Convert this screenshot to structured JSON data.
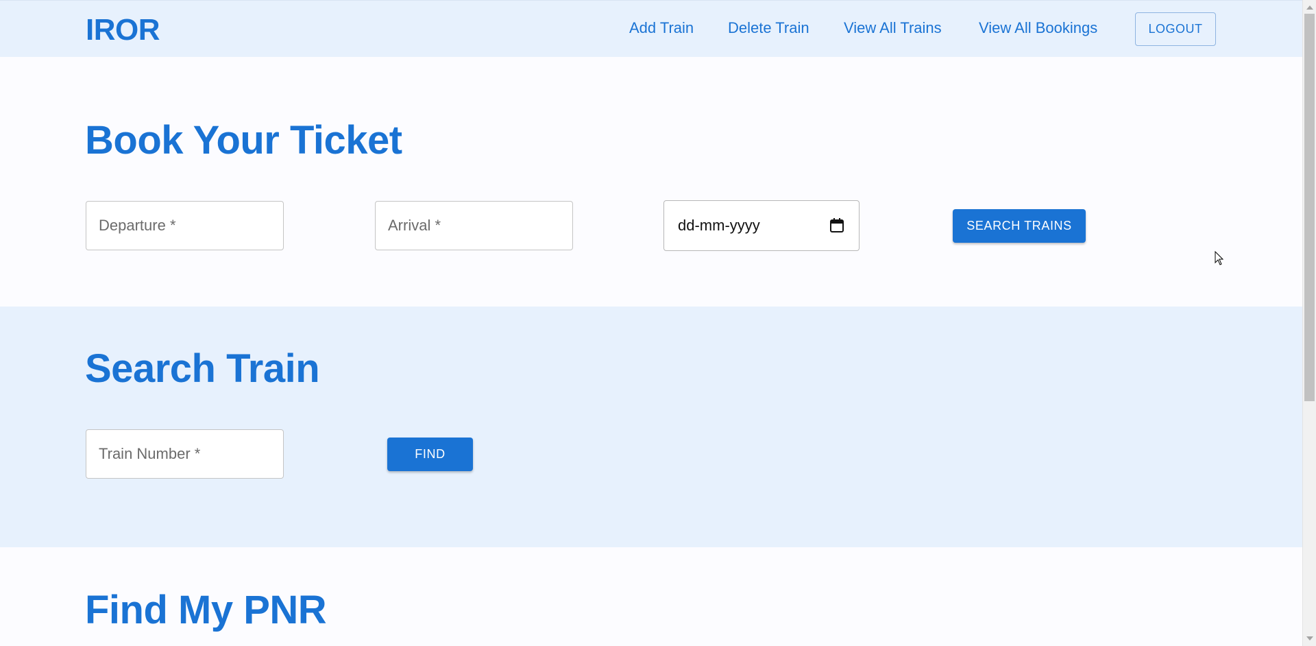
{
  "header": {
    "brand": "IROR",
    "nav": {
      "add_train": "Add Train",
      "delete_train": "Delete Train",
      "view_all_trains": "View All Trains",
      "view_all_bookings": "View All Bookings"
    },
    "logout_label": "LOGOUT"
  },
  "book_ticket": {
    "title": "Book Your Ticket",
    "departure_placeholder": "Departure *",
    "arrival_placeholder": "Arrival *",
    "date_placeholder": "dd-mm-yyyy",
    "search_button": "SEARCH TRAINS"
  },
  "search_train": {
    "title": "Search Train",
    "train_number_placeholder": "Train Number *",
    "find_button": "FIND"
  },
  "find_pnr": {
    "title": "Find My PNR"
  },
  "icons": {
    "calendar": "calendar-icon",
    "cursor": "mouse-pointer-icon"
  },
  "colors": {
    "primary": "#1a73d4",
    "header_bg": "#e7f1fd",
    "section_alt_bg": "#e7f1fd",
    "page_bg": "#fcfcff"
  }
}
